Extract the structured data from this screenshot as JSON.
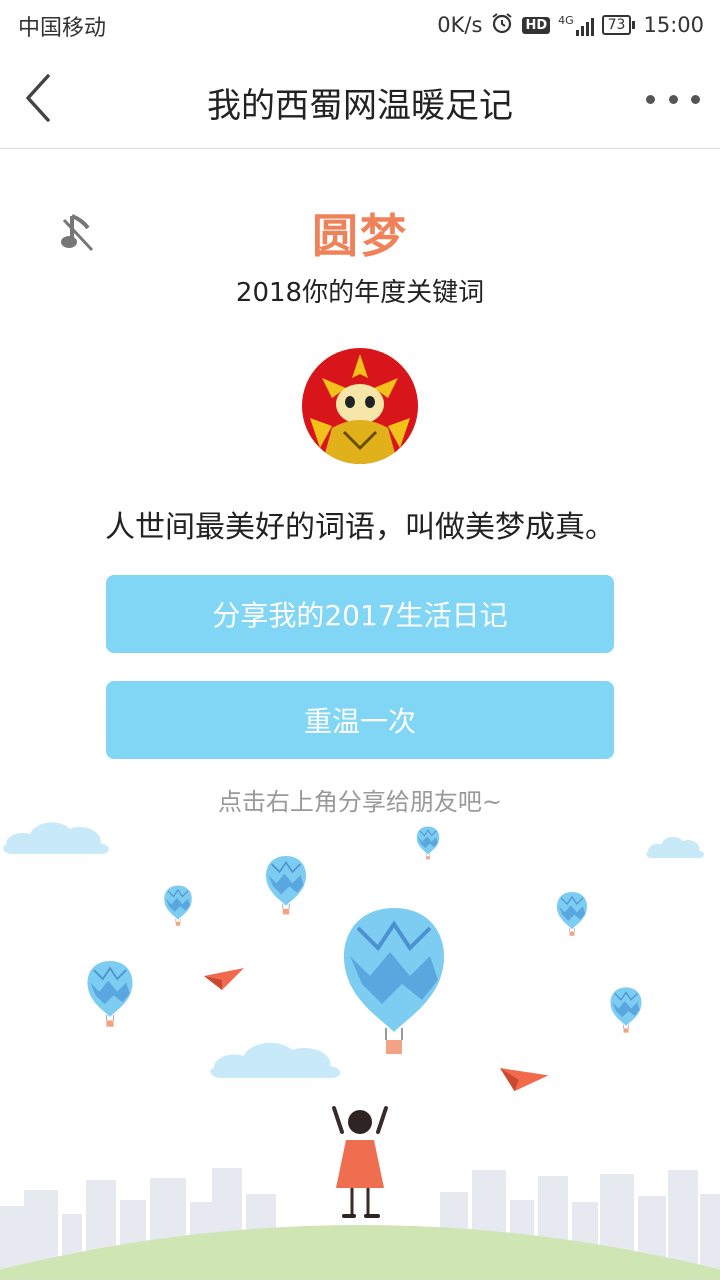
{
  "status_bar": {
    "carrier": "中国移动",
    "net_speed": "0K/s",
    "hd_badge": "HD",
    "network_type": "4G",
    "battery": "73",
    "time": "15:00"
  },
  "nav": {
    "title": "我的西蜀网温暖足记"
  },
  "content": {
    "keyword": "圆梦",
    "subtitle": "2018你的年度关键词",
    "quote": "人世间最美好的词语，叫做美梦成真。",
    "share_button": "分享我的2017生活日记",
    "replay_button": "重温一次",
    "hint": "点击右上角分享给朋友吧~"
  },
  "colors": {
    "keyword": "#f0825a",
    "button": "#82d6f5",
    "balloon": "#6cc2ee",
    "paper_plane": "#f26a4b",
    "hill": "#cfe5b4"
  },
  "icons": {
    "back": "chevron-left-icon",
    "more": "more-dots-icon",
    "music": "music-muted-icon",
    "alarm": "alarm-icon"
  }
}
